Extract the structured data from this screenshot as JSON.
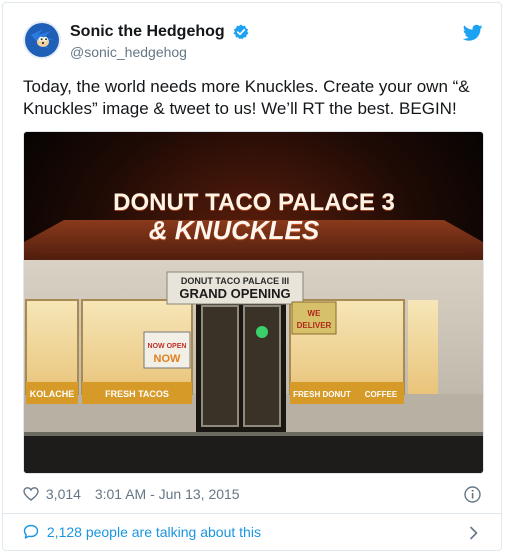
{
  "user": {
    "display_name": "Sonic the Hedgehog",
    "handle": "@sonic_hedgehog",
    "avatar_icon": "sonic-avatar-icon",
    "verified_icon": "verified-badge-icon"
  },
  "tweet": {
    "text": "Today, the world needs more Knuckles. Create your own “& Knuckles” image & tweet to us! We’ll RT the best. BEGIN!"
  },
  "media": {
    "sign_line1": "DONUT TACO PALACE 3",
    "sign_line2": "& KNUCKLES",
    "banner_line1": "DONUT TACO PALACE III",
    "banner_line2": "GRAND OPENING",
    "window_left": "KOLACHE",
    "window_mid": "FRESH TACOS",
    "window_right1": "FRESH DONUT",
    "window_right2": "COFFEE",
    "window_sign_now": "NOW",
    "window_sign_open": "NOW OPEN",
    "window_sign_we": "WE",
    "window_sign_deliver": "DELIVER"
  },
  "meta": {
    "likes": "3,014",
    "timestamp": "3:01 AM - Jun 13, 2015"
  },
  "footer": {
    "talking": "2,128 people are talking about this"
  },
  "colors": {
    "brand_blue": "#1da1f2",
    "link_blue": "#1b95e0",
    "secondary_text": "#657786",
    "neon_sign": "#ff7a3c"
  }
}
